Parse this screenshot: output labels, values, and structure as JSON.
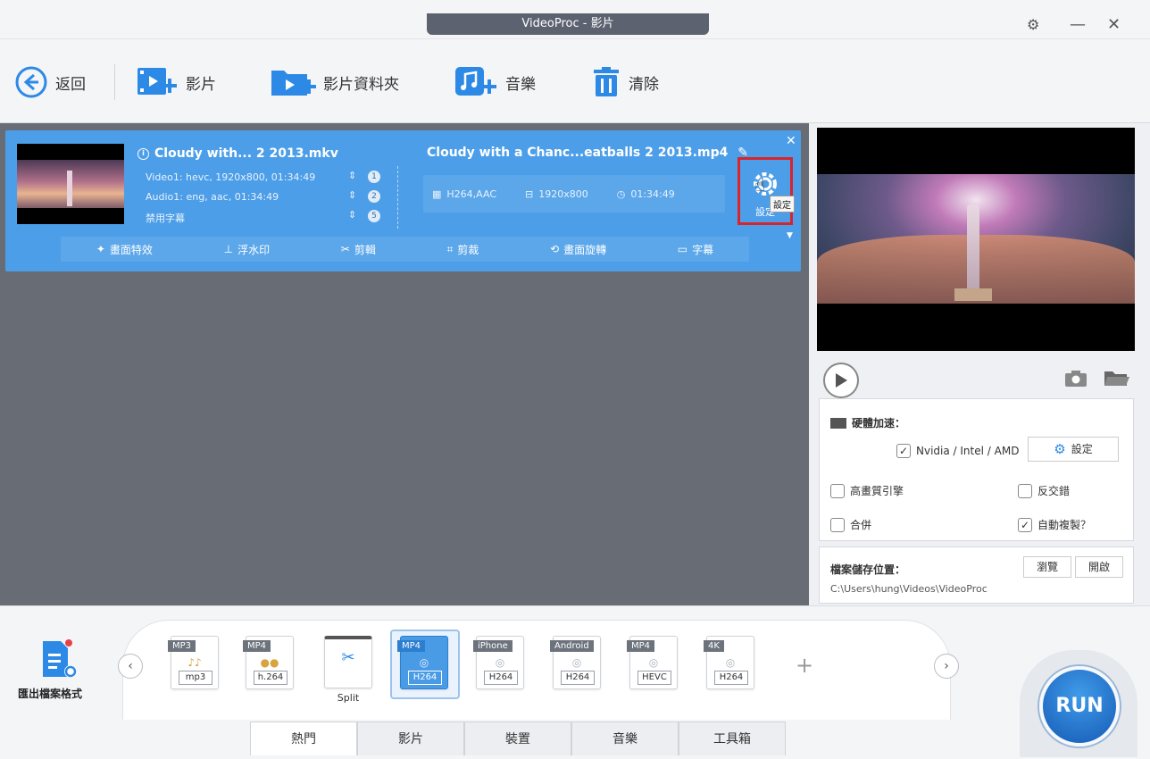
{
  "window": {
    "title": "VideoProc - 影片"
  },
  "toolbar": {
    "back_label": "返回",
    "video_label": "影片",
    "folder_label": "影片資料夾",
    "music_label": "音樂",
    "clear_label": "清除"
  },
  "file": {
    "source_name": "Cloudy with... 2 2013.mkv",
    "video_track": "Video1: hevc, 1920x800, 01:34:49",
    "audio_track": "Audio1: eng, aac, 01:34:49",
    "subtitle_track": "禁用字幕",
    "track_counts": [
      "1",
      "2",
      "5"
    ],
    "output_name": "Cloudy with a Chanc...eatballs 2 2013.mp4",
    "output_codec": "H264,AAC",
    "output_resolution": "1920x800",
    "output_duration": "01:34:49",
    "settings_label": "設定",
    "tooltip": "設定"
  },
  "edit_bar": [
    "畫面特效",
    "浮水印",
    "剪輯",
    "剪裁",
    "畫面旋轉",
    "字幕"
  ],
  "settings": {
    "hw_label": "硬體加速：",
    "hw_option": "Nvidia / Intel / AMD",
    "hw_setting_btn": "設定",
    "high_quality": "高畫質引擎",
    "deinterlace": "反交錯",
    "merge": "合併",
    "auto_copy": "自動複製？"
  },
  "save": {
    "label": "檔案儲存位置：",
    "path": "C:\\Users\\hung\\Videos\\VideoProc",
    "browse_btn": "瀏覽",
    "open_btn": "開啟"
  },
  "export": {
    "label": "匯出檔案格式"
  },
  "formats": [
    {
      "head": "MP3",
      "foot": "mp3"
    },
    {
      "head": "MP4",
      "foot": "h.264"
    },
    {
      "head": "",
      "foot": "Split"
    },
    {
      "head": "MP4",
      "foot": "H264"
    },
    {
      "head": "iPhone",
      "foot": "H264"
    },
    {
      "head": "Android",
      "foot": "H264"
    },
    {
      "head": "MP4",
      "foot": "HEVC"
    },
    {
      "head": "4K",
      "foot": "H264"
    }
  ],
  "tabs": [
    "熱門",
    "影片",
    "裝置",
    "音樂",
    "工具箱"
  ],
  "run_label": "RUN"
}
